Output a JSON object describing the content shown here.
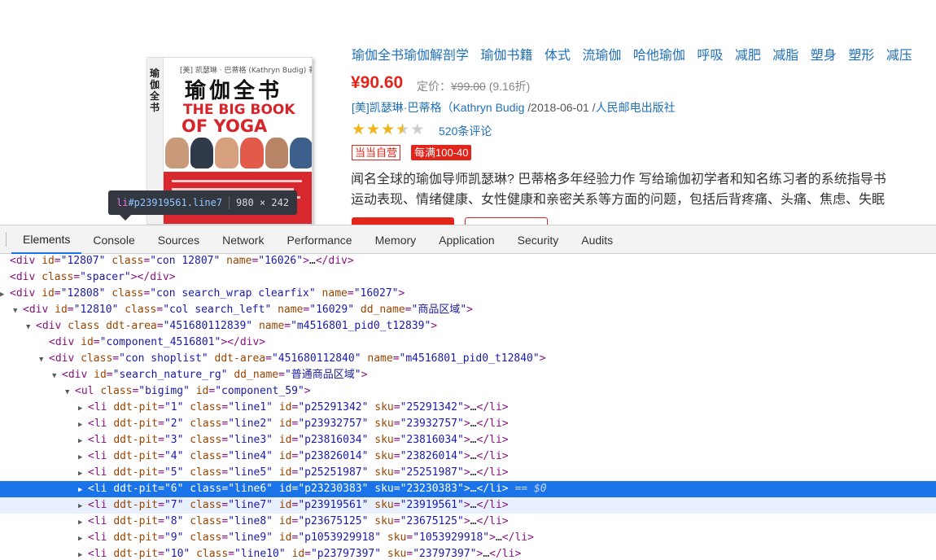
{
  "product": {
    "cover": {
      "spine_text": "瑜伽全书",
      "top_small": "[美] 凯瑟琳 · 巴蒂格 (Kathryn Budig) 著",
      "title_cn": "瑜伽全书",
      "title_en_1": "THE BIG BOOK",
      "title_en_2": "OF YOGA"
    },
    "topics": [
      "瑜伽全书瑜伽解剖学",
      "瑜伽书籍",
      "体式",
      "流瑜伽",
      "哈他瑜伽",
      "呼吸",
      "减肥",
      "减脂",
      "塑身",
      "塑形",
      "减压"
    ],
    "price": "¥90.60",
    "list_price_label": "定价：",
    "list_price": "¥99.00",
    "discount": "(9.16折)",
    "author": "[美]凯瑟琳·巴蒂格（Kathryn Budig",
    "date": "/2018-06-01 /",
    "publisher": "人民邮电出版社",
    "rating": {
      "stars": 3.5,
      "max": 5
    },
    "reviews": "520条评论",
    "badge_self": "当当自营",
    "badge_promo": "每满100-40",
    "description": [
      "闻名全球的瑜伽导师凯瑟琳? 巴蒂格多年经验力作 写给瑜伽初学者和知名练习者的系统指导书",
      "运动表现、情绪健康、女性健康和亲密关系等方面的问题，包括后背疼痛、头痛、焦虑、失眠"
    ]
  },
  "tooltip": {
    "tag": "li",
    "selector": "#p23919561.line7",
    "dims": "980 × 242"
  },
  "devtools": {
    "tabs": [
      "Elements",
      "Console",
      "Sources",
      "Network",
      "Performance",
      "Memory",
      "Application",
      "Security",
      "Audits"
    ],
    "active_tab": "Elements",
    "colors": {
      "tag": "#881280",
      "attr": "#994500",
      "value": "#1a1aa6",
      "selected": "#1a73e8"
    },
    "dom_lines": [
      {
        "caret": "",
        "indent": 0,
        "tag": "div",
        "attrs": [
          [
            "id",
            "12807"
          ],
          [
            "class",
            "con 12807"
          ],
          [
            "name",
            "16026"
          ]
        ],
        "suffix": ">…</div>"
      },
      {
        "caret": "",
        "indent": 0,
        "tag": "div",
        "attrs": [
          [
            "class",
            "spacer"
          ]
        ],
        "suffix": "></div>"
      },
      {
        "caret": "▶",
        "indent": 0,
        "tag": "div",
        "attrs": [
          [
            "id",
            "12808"
          ],
          [
            "class",
            "con search_wrap clearfix"
          ],
          [
            "name",
            "16027"
          ]
        ],
        "suffix": ">"
      },
      {
        "caret": "▼",
        "indent": 1,
        "tag": "div",
        "attrs": [
          [
            "id",
            "12810"
          ],
          [
            "class",
            "col search_left"
          ],
          [
            "name",
            "16029"
          ],
          [
            "dd_name",
            "商品区域"
          ]
        ],
        "suffix": ">"
      },
      {
        "caret": "▼",
        "indent": 2,
        "tag": "div",
        "attrs": [
          [
            "class",
            null
          ],
          [
            "ddt-area",
            "451680112839"
          ],
          [
            "name",
            "m4516801_pid0_t12839"
          ]
        ],
        "suffix": ">"
      },
      {
        "caret": "",
        "indent": 3,
        "tag": "div",
        "attrs": [
          [
            "id",
            "component_4516801"
          ]
        ],
        "suffix": "></div>"
      },
      {
        "caret": "▼",
        "indent": 3,
        "tag": "div",
        "attrs": [
          [
            "class",
            "con shoplist"
          ],
          [
            "ddt-area",
            "451680112840"
          ],
          [
            "name",
            "m4516801_pid0_t12840"
          ]
        ],
        "suffix": ">"
      },
      {
        "caret": "▼",
        "indent": 4,
        "tag": "div",
        "attrs": [
          [
            "id",
            "search_nature_rg"
          ],
          [
            "dd_name",
            "普通商品区域"
          ]
        ],
        "suffix": ">"
      },
      {
        "caret": "▼",
        "indent": 5,
        "tag": "ul",
        "attrs": [
          [
            "class",
            "bigimg"
          ],
          [
            "id",
            "component_59"
          ]
        ],
        "suffix": ">"
      },
      {
        "caret": "▶",
        "indent": 6,
        "tag": "li",
        "attrs": [
          [
            "ddt-pit",
            "1"
          ],
          [
            "class",
            "line1"
          ],
          [
            "id",
            "p25291342"
          ],
          [
            "sku",
            "25291342"
          ]
        ],
        "suffix": ">…</li>"
      },
      {
        "caret": "▶",
        "indent": 6,
        "tag": "li",
        "attrs": [
          [
            "ddt-pit",
            "2"
          ],
          [
            "class",
            "line2"
          ],
          [
            "id",
            "p23932757"
          ],
          [
            "sku",
            "23932757"
          ]
        ],
        "suffix": ">…</li>"
      },
      {
        "caret": "▶",
        "indent": 6,
        "tag": "li",
        "attrs": [
          [
            "ddt-pit",
            "3"
          ],
          [
            "class",
            "line3"
          ],
          [
            "id",
            "p23816034"
          ],
          [
            "sku",
            "23816034"
          ]
        ],
        "suffix": ">…</li>"
      },
      {
        "caret": "▶",
        "indent": 6,
        "tag": "li",
        "attrs": [
          [
            "ddt-pit",
            "4"
          ],
          [
            "class",
            "line4"
          ],
          [
            "id",
            "p23826014"
          ],
          [
            "sku",
            "23826014"
          ]
        ],
        "suffix": ">…</li>"
      },
      {
        "caret": "▶",
        "indent": 6,
        "tag": "li",
        "attrs": [
          [
            "ddt-pit",
            "5"
          ],
          [
            "class",
            "line5"
          ],
          [
            "id",
            "p25251987"
          ],
          [
            "sku",
            "25251987"
          ]
        ],
        "suffix": ">…</li>"
      },
      {
        "caret": "▶",
        "indent": 6,
        "tag": "li",
        "attrs": [
          [
            "ddt-pit",
            "6"
          ],
          [
            "class",
            "line6"
          ],
          [
            "id",
            "p23230383"
          ],
          [
            "sku",
            "23230383"
          ]
        ],
        "suffix": ">…</li>",
        "selected": true,
        "note": " == $0"
      },
      {
        "caret": "▶",
        "indent": 6,
        "tag": "li",
        "attrs": [
          [
            "ddt-pit",
            "7"
          ],
          [
            "class",
            "line7"
          ],
          [
            "id",
            "p23919561"
          ],
          [
            "sku",
            "23919561"
          ]
        ],
        "suffix": ">…</li>",
        "hovered": true
      },
      {
        "caret": "▶",
        "indent": 6,
        "tag": "li",
        "attrs": [
          [
            "ddt-pit",
            "8"
          ],
          [
            "class",
            "line8"
          ],
          [
            "id",
            "p23675125"
          ],
          [
            "sku",
            "23675125"
          ]
        ],
        "suffix": ">…</li>"
      },
      {
        "caret": "▶",
        "indent": 6,
        "tag": "li",
        "attrs": [
          [
            "ddt-pit",
            "9"
          ],
          [
            "class",
            "line9"
          ],
          [
            "id",
            "p1053929918"
          ],
          [
            "sku",
            "1053929918"
          ]
        ],
        "suffix": ">…</li>"
      },
      {
        "caret": "▶",
        "indent": 6,
        "tag": "li",
        "attrs": [
          [
            "ddt-pit",
            "10"
          ],
          [
            "class",
            "line10"
          ],
          [
            "id",
            "p23797397"
          ],
          [
            "sku",
            "23797397"
          ]
        ],
        "suffix": ">…</li>"
      }
    ]
  }
}
